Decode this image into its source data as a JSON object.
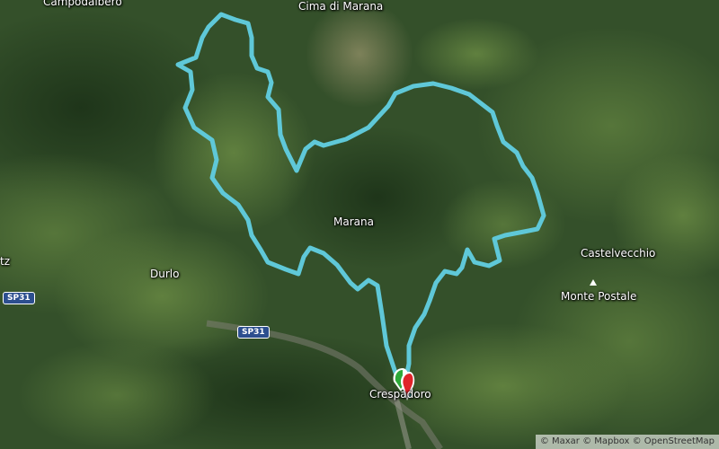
{
  "map": {
    "labels": {
      "campodalbero": "Campodalbero",
      "cima_di_marana": "Cima di Marana",
      "marana": "Marana",
      "castelvecchio": "Castelvecchio",
      "monte_postale": "Monte Postale",
      "durlo": "Durlo",
      "crespadoro": "Crespadoro",
      "edge_fragment": "tz"
    },
    "road_shields": [
      "SP31",
      "SP31"
    ],
    "attribution": "© Maxar © Mapbox © OpenStreetMap",
    "colors": {
      "route": "#5fc8d8",
      "start_marker_green": "#2eaa3a",
      "end_marker_red": "#e0242a",
      "shield": "#2d4f8f"
    }
  }
}
